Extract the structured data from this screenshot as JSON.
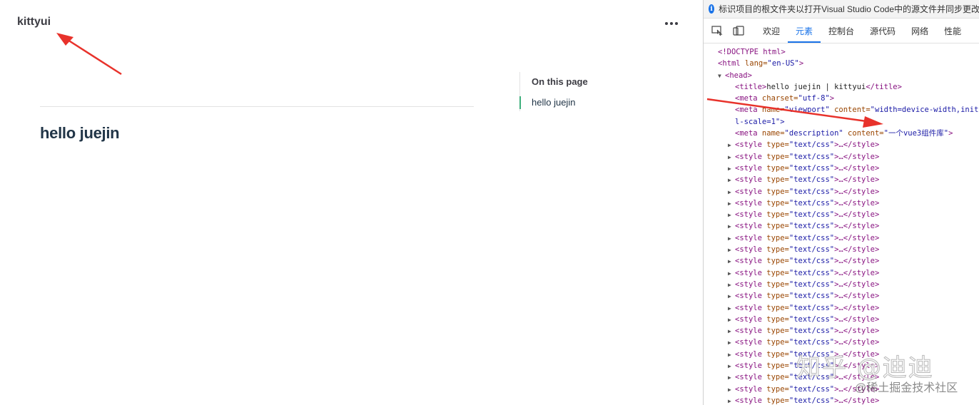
{
  "site": {
    "brand": "kittyui",
    "heading": "hello juejin",
    "outline_title": "On this page",
    "outline_link": "hello juejin"
  },
  "devtools": {
    "info": "标识项目的根文件夹以打开Visual Studio Code中的源文件并同步更改",
    "tabs": [
      "欢迎",
      "元素",
      "控制台",
      "源代码",
      "网络",
      "性能"
    ],
    "active_tab": "元素",
    "code": {
      "doctype": "<!DOCTYPE html>",
      "html_open_tag": "<html",
      "html_lang_attr": " lang=",
      "html_lang_val": "\"en-US\"",
      "html_close_bracket": ">",
      "head_tag": "<head>",
      "title_open": "<title>",
      "title_text": "hello juejin | kittyui",
      "title_close": "</title>",
      "meta_open": "<meta",
      "charset_attr": " charset=",
      "charset_val": "\"utf-8\"",
      "gt": ">",
      "name_attr": " name=",
      "viewport_val": "\"viewport\"",
      "content_attr": " content=",
      "viewport_content": "\"width=device-width,initia",
      "viewport_wrap": "l-scale=1\">",
      "description_val": "\"description\"",
      "description_content": "\"一个vue3组件库\"",
      "style_open": "<style",
      "type_attr": " type=",
      "style_type_val": "\"text/css\"",
      "style_ellipsis": ">…",
      "style_close": "</style>"
    },
    "style_rows": 23
  },
  "watermark": {
    "line1": "知乎 @迪迪",
    "line2": "@稀土掘金技术社区"
  },
  "colors": {
    "arrow": "#e8322b",
    "accent_tab": "#1a73e8",
    "tag": "#881280",
    "attr": "#994500",
    "value": "#1a1aa6"
  }
}
